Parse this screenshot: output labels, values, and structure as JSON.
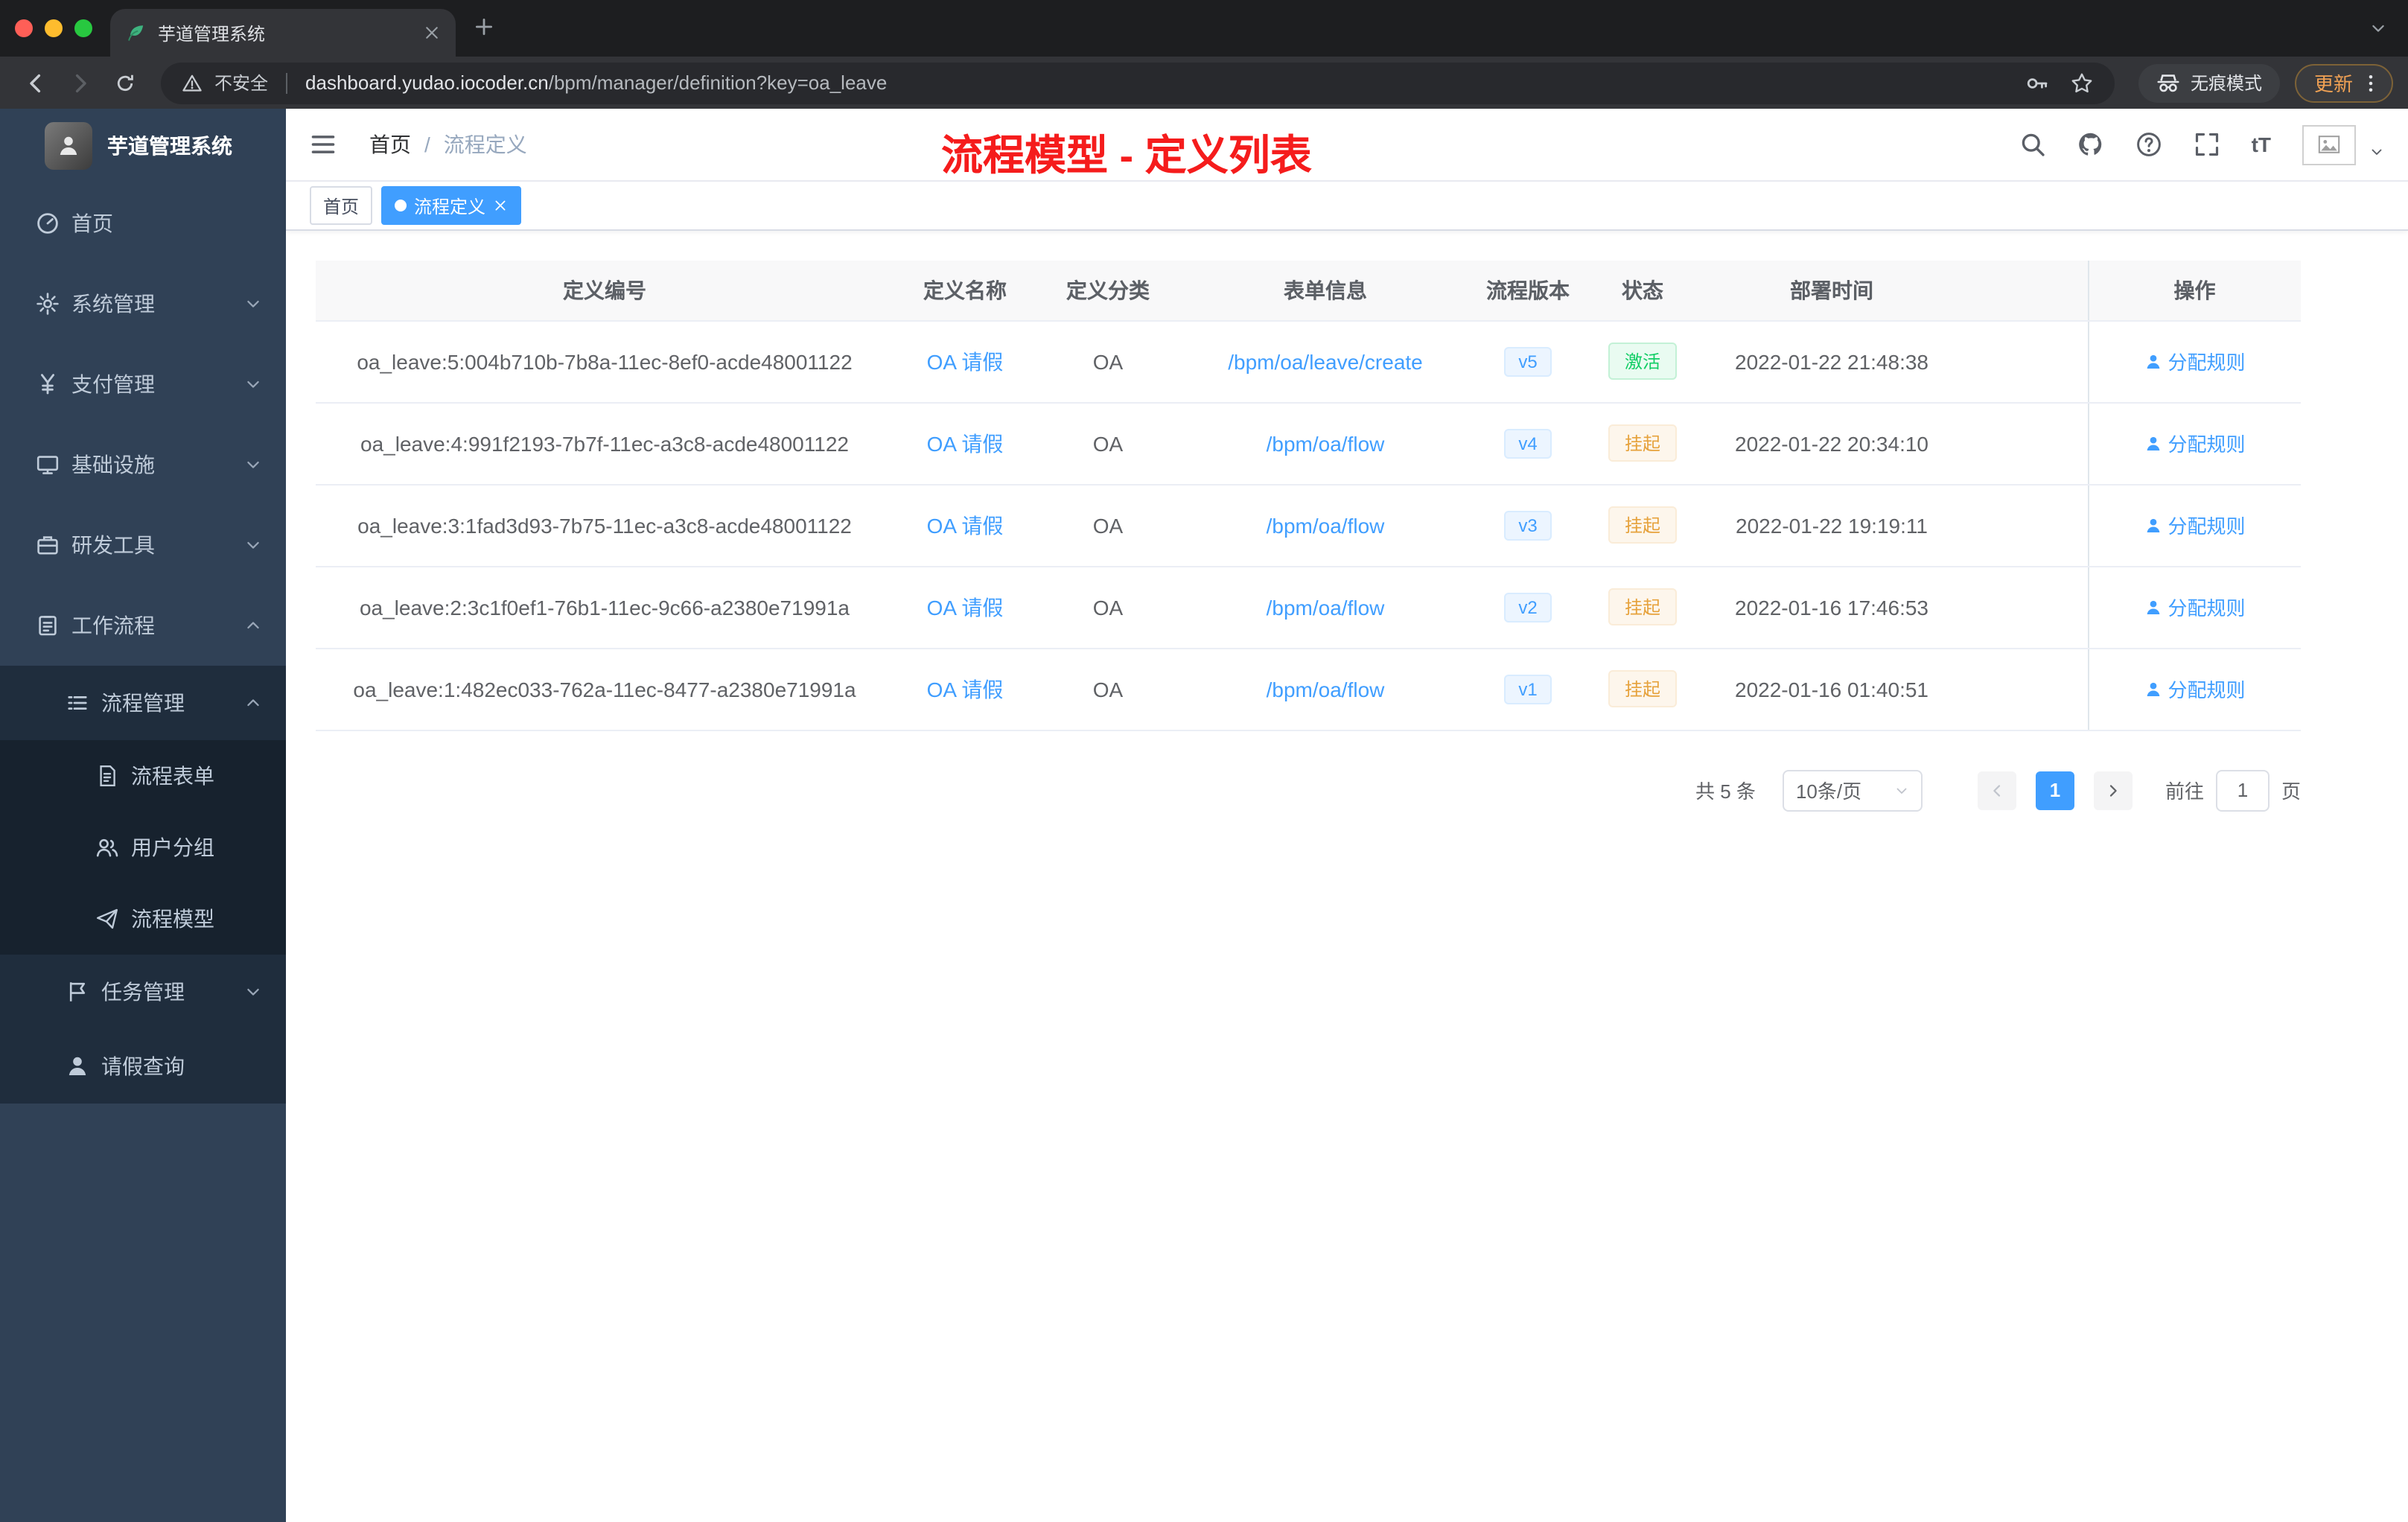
{
  "browser": {
    "tab_title": "芋道管理系统",
    "security_label": "不安全",
    "url_domain": "dashboard.yudao.iocoder.cn",
    "url_path": "/bpm/manager/definition?key=oa_leave",
    "incognito_label": "无痕模式",
    "update_label": "更新"
  },
  "sidebar": {
    "app_title": "芋道管理系统",
    "menu": {
      "home": "首页",
      "system": "系统管理",
      "payment": "支付管理",
      "infra": "基础设施",
      "devtools": "研发工具",
      "workflow": "工作流程",
      "process_mgmt": "流程管理",
      "process_form": "流程表单",
      "user_group": "用户分组",
      "process_model": "流程模型",
      "task_mgmt": "任务管理",
      "leave_query": "请假查询"
    }
  },
  "navbar": {
    "breadcrumb_home": "首页",
    "breadcrumb_separator": "/",
    "breadcrumb_current": "流程定义",
    "size_icon_label": "tT"
  },
  "annotation": {
    "text": "流程模型 - 定义列表"
  },
  "tags": {
    "home": "首页",
    "active": "流程定义"
  },
  "table": {
    "headers": [
      "定义编号",
      "定义名称",
      "定义分类",
      "表单信息",
      "流程版本",
      "状态",
      "部署时间",
      "操作"
    ],
    "rows": [
      {
        "id": "oa_leave:5:004b710b-7b8a-11ec-8ef0-acde48001122",
        "name": "OA 请假",
        "category": "OA",
        "form": "/bpm/oa/leave/create",
        "version": "v5",
        "status": "激活",
        "status_type": "success",
        "deploy_time": "2022-01-22 21:48:38",
        "action": "分配规则"
      },
      {
        "id": "oa_leave:4:991f2193-7b7f-11ec-a3c8-acde48001122",
        "name": "OA 请假",
        "category": "OA",
        "form": "/bpm/oa/flow",
        "version": "v4",
        "status": "挂起",
        "status_type": "warning",
        "deploy_time": "2022-01-22 20:34:10",
        "action": "分配规则"
      },
      {
        "id": "oa_leave:3:1fad3d93-7b75-11ec-a3c8-acde48001122",
        "name": "OA 请假",
        "category": "OA",
        "form": "/bpm/oa/flow",
        "version": "v3",
        "status": "挂起",
        "status_type": "warning",
        "deploy_time": "2022-01-22 19:19:11",
        "action": "分配规则"
      },
      {
        "id": "oa_leave:2:3c1f0ef1-76b1-11ec-9c66-a2380e71991a",
        "name": "OA 请假",
        "category": "OA",
        "form": "/bpm/oa/flow",
        "version": "v2",
        "status": "挂起",
        "status_type": "warning",
        "deploy_time": "2022-01-16 17:46:53",
        "action": "分配规则"
      },
      {
        "id": "oa_leave:1:482ec033-762a-11ec-8477-a2380e71991a",
        "name": "OA 请假",
        "category": "OA",
        "form": "/bpm/oa/flow",
        "version": "v1",
        "status": "挂起",
        "status_type": "warning",
        "deploy_time": "2022-01-16 01:40:51",
        "action": "分配规则"
      }
    ]
  },
  "pagination": {
    "total": "共 5 条",
    "page_size": "10条/页",
    "current_page": "1",
    "goto_label": "前往",
    "goto_value": "1",
    "unit_label": "页"
  },
  "colors": {
    "accent": "#409eff",
    "sidebar_bg": "#304156",
    "submenu_bg": "#1f2d3d",
    "success": "#13ce66",
    "warning": "#e6a23c",
    "annotation_red": "#f51c1c"
  }
}
